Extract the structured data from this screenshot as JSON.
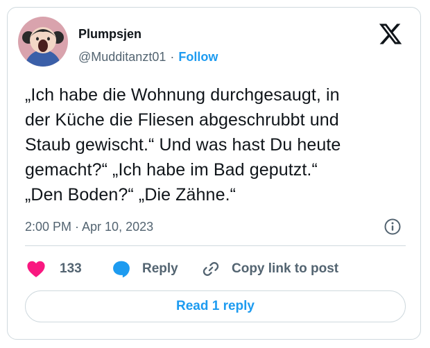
{
  "author": {
    "name": "Plumpsjen",
    "handle": "@Mudditanzt01",
    "separator": "·",
    "follow_label": "Follow"
  },
  "brand_icon": "x-logo-icon",
  "tweet": {
    "text": "„Ich habe die Wohnung durchgesaugt, in\nder Küche die Fliesen abgeschrubbt und\nStaub gewischt.“ Und was hast Du heute\ngemacht?“ „Ich habe im Bad geputzt.“\n„Den Boden?“ „Die Zähne.“",
    "timestamp": "2:00 PM · Apr 10, 2023"
  },
  "actions": {
    "like": {
      "icon": "heart-icon",
      "count": "133",
      "color": "#f91880"
    },
    "reply": {
      "icon": "speech-bubble-icon",
      "label": "Reply",
      "color": "#1d9bf0"
    },
    "copy_link": {
      "icon": "link-icon",
      "label": "Copy link to post"
    }
  },
  "read_replies_label": "Read 1 reply",
  "colors": {
    "accent": "#1d9bf0",
    "text": "#0f1419",
    "muted": "#536471",
    "border": "#cfd9de"
  }
}
